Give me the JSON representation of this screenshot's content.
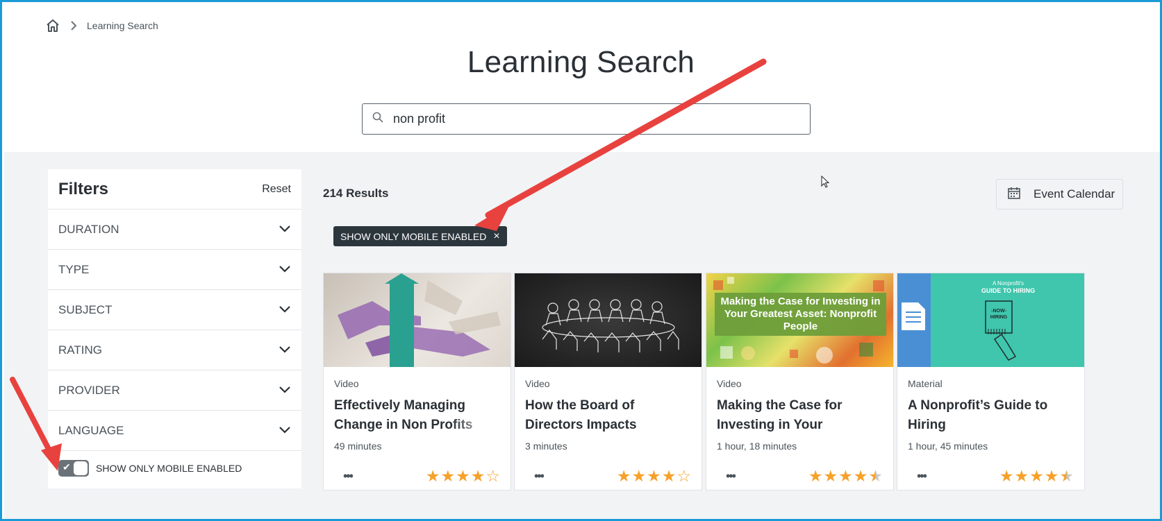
{
  "breadcrumb": {
    "home_icon": "home-icon",
    "current": "Learning Search"
  },
  "page_title": "Learning Search",
  "search": {
    "value": "non profit",
    "icon": "search-icon"
  },
  "filters": {
    "title": "Filters",
    "reset": "Reset",
    "rows": [
      {
        "label": "DURATION"
      },
      {
        "label": "TYPE"
      },
      {
        "label": "SUBJECT"
      },
      {
        "label": "RATING"
      },
      {
        "label": "PROVIDER"
      },
      {
        "label": "LANGUAGE"
      }
    ],
    "mobile_toggle": {
      "label": "SHOW ONLY MOBILE ENABLED",
      "checked": true
    }
  },
  "results": {
    "count": "214 Results"
  },
  "event_calendar": {
    "label": "Event Calendar",
    "icon": "calendar-icon"
  },
  "active_filter_chip": {
    "label": "SHOW ONLY MOBILE ENABLED",
    "remove": "×"
  },
  "cards": [
    {
      "type": "Video",
      "title": "Effectively Managing Change in Non Profits",
      "duration": "49 minutes",
      "rating": 4,
      "more": "•••"
    },
    {
      "type": "Video",
      "title": "How the Board of Directors Impacts Nonprofit",
      "duration": "3 minutes",
      "rating": 4,
      "more": "•••"
    },
    {
      "type": "Video",
      "title": "Making the Case for Investing in Your",
      "duration": "1 hour, 18 minutes",
      "rating": 4.5,
      "more": "•••",
      "thumb_text": "Making the Case for Investing in Your Greatest Asset: Nonprofit People"
    },
    {
      "type": "Material",
      "title": "A Nonprofit’s Guide to Hiring",
      "duration": "1 hour, 45 minutes",
      "rating": 4.5,
      "more": "•••",
      "thumb_small": "A Nonprofit's",
      "thumb_big": "GUIDE TO HIRING",
      "thumb_sign": "-NOW- HIRING"
    }
  ],
  "colors": {
    "accent_border": "#1a9bd7",
    "chip_bg": "#2c363d",
    "star": "#f6a12a",
    "arrow": "#e8423f",
    "thumb_teal": "#3fc6ad",
    "thumb_blue": "#4a8fd4"
  }
}
